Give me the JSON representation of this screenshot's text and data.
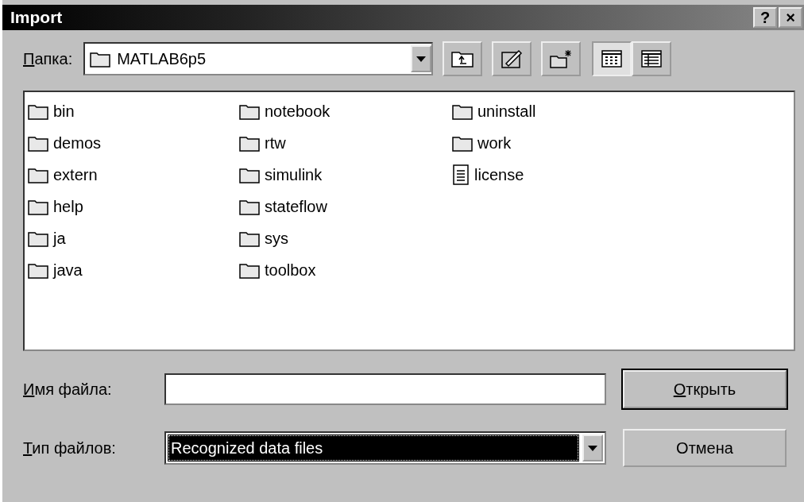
{
  "window": {
    "title": "Import",
    "buttons": [
      "?",
      "×"
    ]
  },
  "folder_bar": {
    "label": "Папка:",
    "value": "MATLAB6p5",
    "view_buttons": [
      {
        "kind": "list",
        "selected": true
      },
      {
        "kind": "details",
        "selected": false
      }
    ]
  },
  "files": [
    {
      "name": "bin",
      "kind": "folder"
    },
    {
      "name": "demos",
      "kind": "folder"
    },
    {
      "name": "extern",
      "kind": "folder"
    },
    {
      "name": "help",
      "kind": "folder"
    },
    {
      "name": "ja",
      "kind": "folder"
    },
    {
      "name": "java",
      "kind": "folder"
    },
    {
      "name": "notebook",
      "kind": "folder"
    },
    {
      "name": "rtw",
      "kind": "folder"
    },
    {
      "name": "simulink",
      "kind": "folder"
    },
    {
      "name": "stateflow",
      "kind": "folder"
    },
    {
      "name": "sys",
      "kind": "folder"
    },
    {
      "name": "toolbox",
      "kind": "folder"
    },
    {
      "name": "uninstall",
      "kind": "folder"
    },
    {
      "name": "work",
      "kind": "folder"
    },
    {
      "name": "license",
      "kind": "file"
    }
  ],
  "file_name": {
    "label": "Имя файла:"
  },
  "file_type": {
    "label": "Тип файлов:",
    "value": "Recognized data files"
  },
  "buttons": [
    {
      "label": "Открыть",
      "default": true
    },
    {
      "label": "Отмена",
      "default": false
    }
  ]
}
